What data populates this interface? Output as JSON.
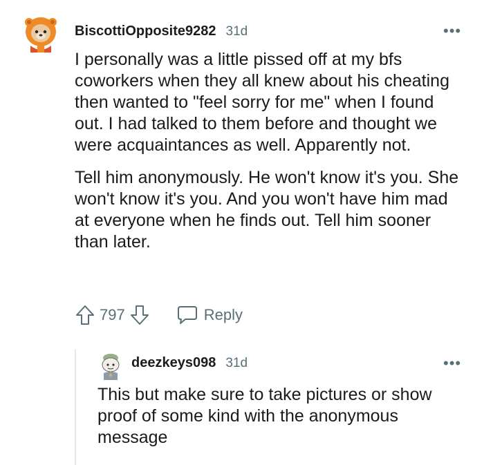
{
  "comment": {
    "username": "BiscottiOpposite9282",
    "age": "31d",
    "more_label": "•••",
    "paragraphs": [
      "I personally was a little pissed off at my bfs coworkers when they all knew about his cheating then wanted to \"feel sorry for me\" when I found out. I had talked to them before and thought we were acquaintances as well. Apparently not.",
      "Tell him anonymously. He won't know it's you. She won't know it's you. And you won't have him mad at everyone when he finds out. Tell him sooner than later."
    ],
    "score": "797",
    "reply_label": "Reply",
    "avatar_icon": "snoo-lion-hoodie-avatar"
  },
  "reply": {
    "username": "deezkeys098",
    "age": "31d",
    "more_label": "•••",
    "paragraphs": [
      "This but make sure to take pictures or show proof of some kind with the anonymous message"
    ],
    "avatar_icon": "snoo-avatar"
  },
  "colors": {
    "text": "#1a1a1b",
    "meta": "#576f76",
    "avatar_orange": "#f08a24",
    "thread_line": "#e5e7e8"
  }
}
